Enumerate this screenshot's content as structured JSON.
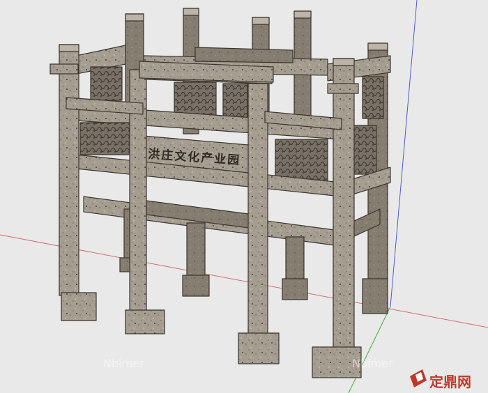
{
  "scene": {
    "description_kind": "sketchup-model-render",
    "background_color": "#e9e9e9",
    "stone_color": "#a59c90",
    "stone_dark": "#6f675d",
    "axis_colors": {
      "red": "#d46a6a",
      "green": "#3cb043",
      "blue": "#4a5bd6"
    }
  },
  "inscription": {
    "text": "洪庄文化产业园"
  },
  "watermarks": {
    "left": "Nbimer",
    "right": "Nbimer"
  },
  "logo": {
    "text": "定鼎网",
    "color": "#c0392b"
  }
}
